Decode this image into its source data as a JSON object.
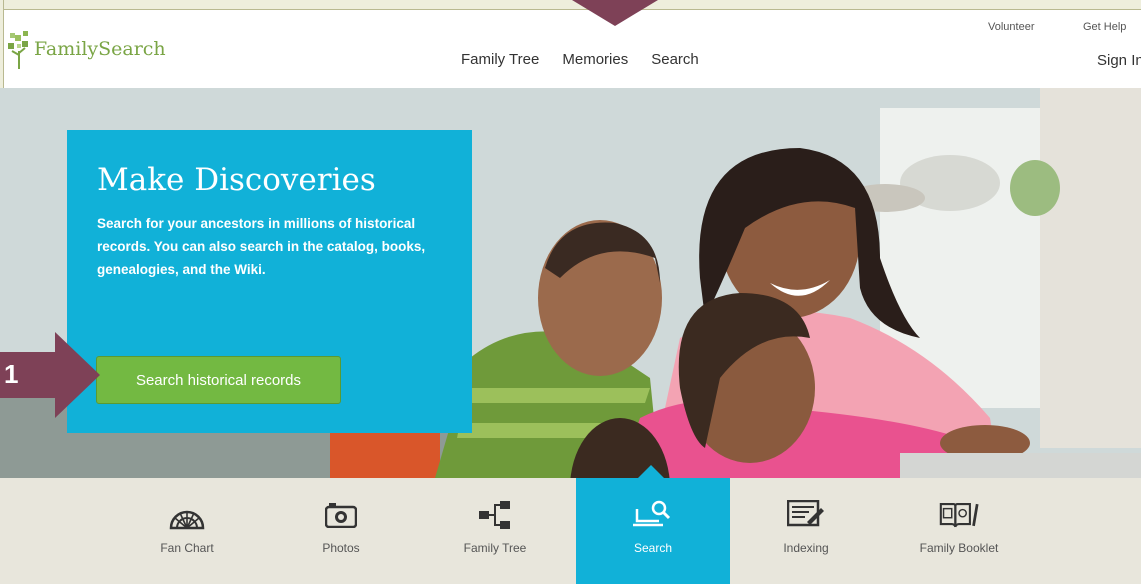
{
  "header": {
    "logo_text": "FamilySearch",
    "nav": [
      "Family Tree",
      "Memories",
      "Search"
    ],
    "utility": [
      "Volunteer",
      "Get Help"
    ],
    "sign_in": "Sign In"
  },
  "hero": {
    "title": "Make Discoveries",
    "body": "Search for your ancestors in millions of historical records. You can also search in the catalog, books, genealogies, and the Wiki.",
    "button_label": "Search historical records"
  },
  "callout": {
    "step": "1"
  },
  "toolbar": {
    "items": [
      {
        "label": "Fan Chart",
        "icon": "fan-chart-icon"
      },
      {
        "label": "Photos",
        "icon": "camera-icon"
      },
      {
        "label": "Family Tree",
        "icon": "family-tree-icon"
      },
      {
        "label": "Search",
        "icon": "search-computer-icon",
        "active": true
      },
      {
        "label": "Indexing",
        "icon": "indexing-icon"
      },
      {
        "label": "Family Booklet",
        "icon": "booklet-icon"
      }
    ]
  },
  "colors": {
    "brand_green": "#7aa545",
    "accent_blue": "#11b1d8",
    "button_green": "#73b942",
    "callout_purple": "#7e4157"
  }
}
